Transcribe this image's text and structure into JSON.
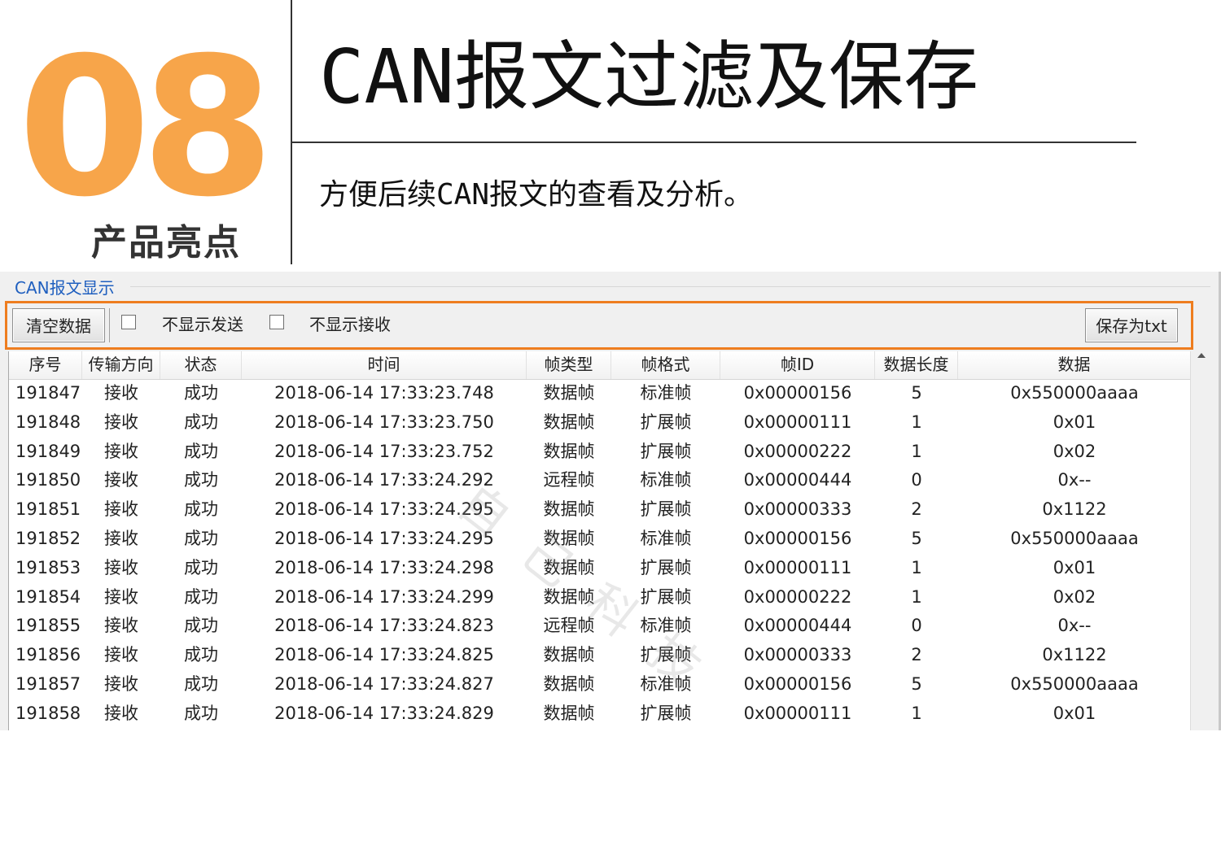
{
  "header": {
    "number": "08",
    "section_label": "产品亮点",
    "headline": "CAN报文过滤及保存",
    "description": "方便后续CAN报文的查看及分析。"
  },
  "colors": {
    "accent_orange": "#f7a54a",
    "toolbar_border": "#ee7d1f",
    "group_title_blue": "#1f5fbf"
  },
  "window": {
    "group_title": "CAN报文显示",
    "toolbar": {
      "clear_button": "清空数据",
      "hide_send_checkbox": {
        "label": "不显示发送",
        "checked": false
      },
      "hide_receive_checkbox": {
        "label": "不显示接收",
        "checked": false
      },
      "save_button": "保存为txt"
    },
    "watermark": "自 己 科 技",
    "table": {
      "columns": [
        "序号",
        "传输方向",
        "状态",
        "时间",
        "帧类型",
        "帧格式",
        "帧ID",
        "数据长度",
        "数据"
      ],
      "rows": [
        [
          "191847",
          "接收",
          "成功",
          "2018-06-14 17:33:23.748",
          "数据帧",
          "标准帧",
          "0x00000156",
          "5",
          "0x550000aaaa"
        ],
        [
          "191848",
          "接收",
          "成功",
          "2018-06-14 17:33:23.750",
          "数据帧",
          "扩展帧",
          "0x00000111",
          "1",
          "0x01"
        ],
        [
          "191849",
          "接收",
          "成功",
          "2018-06-14 17:33:23.752",
          "数据帧",
          "扩展帧",
          "0x00000222",
          "1",
          "0x02"
        ],
        [
          "191850",
          "接收",
          "成功",
          "2018-06-14 17:33:24.292",
          "远程帧",
          "标准帧",
          "0x00000444",
          "0",
          "0x--"
        ],
        [
          "191851",
          "接收",
          "成功",
          "2018-06-14 17:33:24.295",
          "数据帧",
          "扩展帧",
          "0x00000333",
          "2",
          "0x1122"
        ],
        [
          "191852",
          "接收",
          "成功",
          "2018-06-14 17:33:24.295",
          "数据帧",
          "标准帧",
          "0x00000156",
          "5",
          "0x550000aaaa"
        ],
        [
          "191853",
          "接收",
          "成功",
          "2018-06-14 17:33:24.298",
          "数据帧",
          "扩展帧",
          "0x00000111",
          "1",
          "0x01"
        ],
        [
          "191854",
          "接收",
          "成功",
          "2018-06-14 17:33:24.299",
          "数据帧",
          "扩展帧",
          "0x00000222",
          "1",
          "0x02"
        ],
        [
          "191855",
          "接收",
          "成功",
          "2018-06-14 17:33:24.823",
          "远程帧",
          "标准帧",
          "0x00000444",
          "0",
          "0x--"
        ],
        [
          "191856",
          "接收",
          "成功",
          "2018-06-14 17:33:24.825",
          "数据帧",
          "扩展帧",
          "0x00000333",
          "2",
          "0x1122"
        ],
        [
          "191857",
          "接收",
          "成功",
          "2018-06-14 17:33:24.827",
          "数据帧",
          "标准帧",
          "0x00000156",
          "5",
          "0x550000aaaa"
        ],
        [
          "191858",
          "接收",
          "成功",
          "2018-06-14 17:33:24.829",
          "数据帧",
          "扩展帧",
          "0x00000111",
          "1",
          "0x01"
        ]
      ]
    }
  }
}
